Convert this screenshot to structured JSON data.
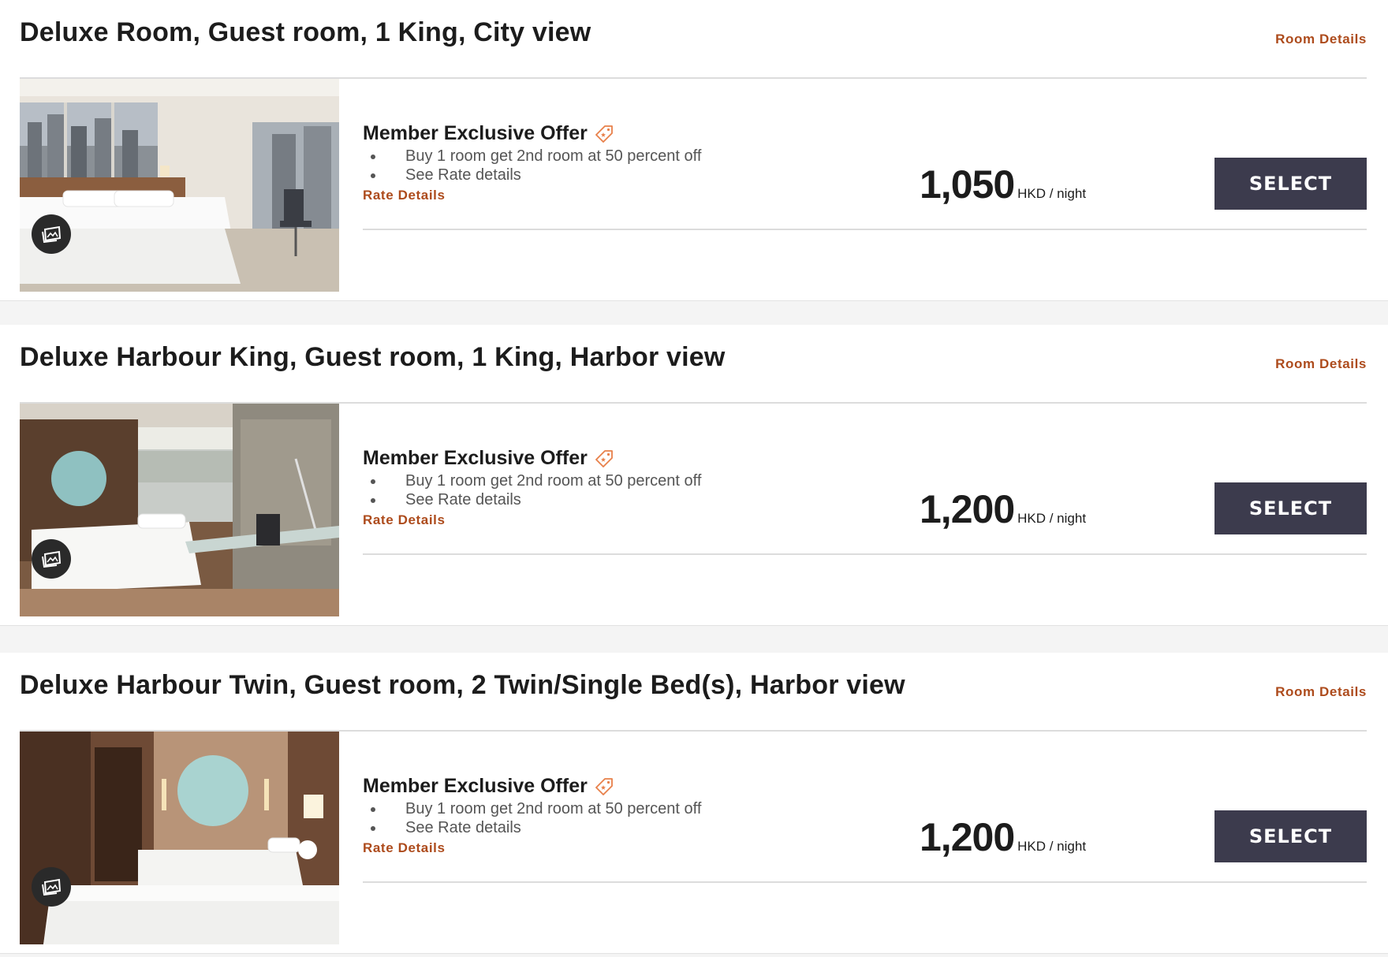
{
  "rooms": [
    {
      "title": "Deluxe Room, Guest room, 1 King, City view",
      "room_details_label": "Room Details",
      "offer_title": "Member Exclusive Offer",
      "bullets": [
        "Buy 1 room get 2nd room at 50 percent off",
        "See Rate details"
      ],
      "rate_details_label": "Rate Details",
      "price": "1,050",
      "price_unit": "HKD / night",
      "select_label": "SELECT"
    },
    {
      "title": "Deluxe Harbour King, Guest room, 1 King, Harbor view",
      "room_details_label": "Room Details",
      "offer_title": "Member Exclusive Offer",
      "bullets": [
        "Buy 1 room get 2nd room at 50 percent off",
        "See Rate details"
      ],
      "rate_details_label": "Rate Details",
      "price": "1,200",
      "price_unit": "HKD / night",
      "select_label": "SELECT"
    },
    {
      "title": "Deluxe Harbour Twin, Guest room, 2 Twin/Single Bed(s), Harbor view",
      "room_details_label": "Room Details",
      "offer_title": "Member Exclusive Offer",
      "bullets": [
        "Buy 1 room get 2nd room at 50 percent off",
        "See Rate details"
      ],
      "rate_details_label": "Rate Details",
      "price": "1,200",
      "price_unit": "HKD / night",
      "select_label": "SELECT"
    }
  ],
  "colors": {
    "accent_link": "#ad4b1c",
    "select_button": "#3c3b4d",
    "tag_icon": "#e8804a"
  },
  "icons": {
    "gallery": "photo-gallery-icon",
    "offer": "price-tag-icon"
  }
}
